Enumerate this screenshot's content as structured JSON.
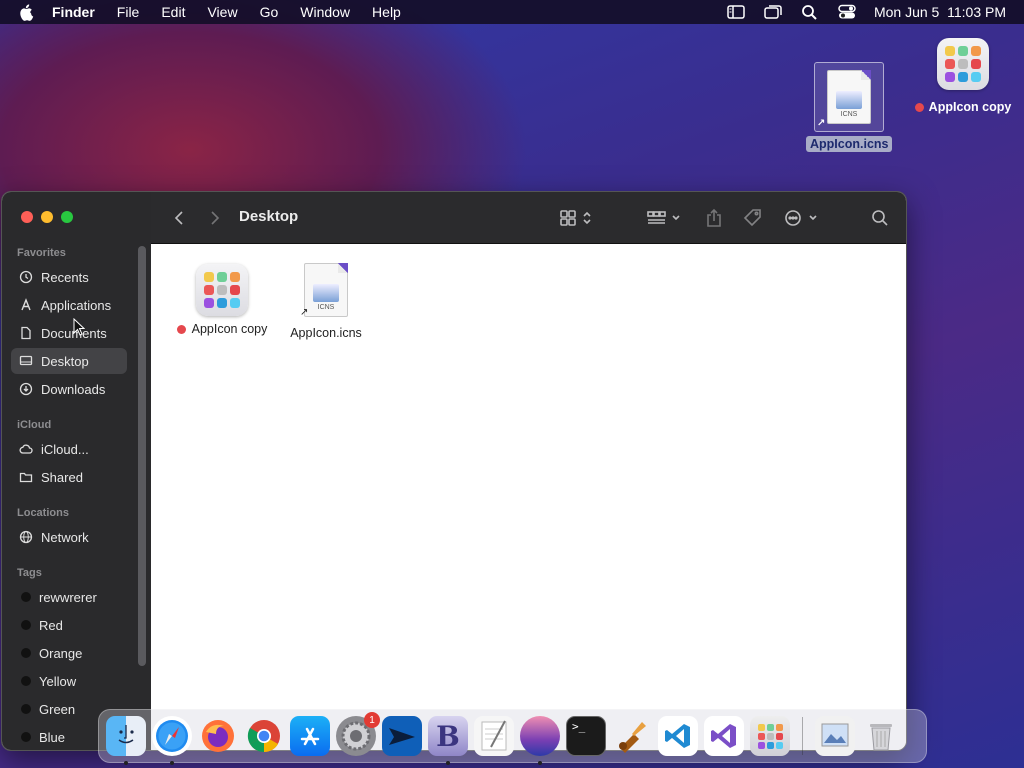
{
  "menubar": {
    "apple_icon": "apple-icon",
    "app_name": "Finder",
    "menus": [
      "File",
      "Edit",
      "View",
      "Go",
      "Window",
      "Help"
    ],
    "status_icons": [
      "sidebar-icon",
      "screen-mirroring-icon",
      "search-icon",
      "control-center-icon"
    ],
    "clock": "Mon Jun 5  11:03 PM"
  },
  "desktop": {
    "icons": [
      {
        "label": "AppIcon.icns",
        "type": "icns-document",
        "selected": true
      },
      {
        "label": "AppIcon copy",
        "type": "app",
        "tag_color": "#e5484d"
      }
    ]
  },
  "finder": {
    "title": "Desktop",
    "sidebar": {
      "sections": [
        {
          "heading": "Favorites",
          "items": [
            {
              "label": "Recents",
              "icon": "clock-icon"
            },
            {
              "label": "Applications",
              "icon": "applications-icon"
            },
            {
              "label": "Documents",
              "icon": "document-icon"
            },
            {
              "label": "Desktop",
              "icon": "desktop-icon",
              "selected": true
            },
            {
              "label": "Downloads",
              "icon": "download-icon"
            }
          ]
        },
        {
          "heading": "iCloud",
          "items": [
            {
              "label": "iCloud...",
              "icon": "cloud-icon"
            },
            {
              "label": "Shared",
              "icon": "shared-folder-icon"
            }
          ]
        },
        {
          "heading": "Locations",
          "items": [
            {
              "label": "Network",
              "icon": "globe-icon"
            }
          ]
        },
        {
          "heading": "Tags",
          "items": [
            {
              "label": "rewwrerer",
              "color": "#111111"
            },
            {
              "label": "Red",
              "color": "#111111"
            },
            {
              "label": "Orange",
              "color": "#111111"
            },
            {
              "label": "Yellow",
              "color": "#111111"
            },
            {
              "label": "Green",
              "color": "#111111"
            },
            {
              "label": "Blue",
              "color": "#111111"
            }
          ]
        }
      ]
    },
    "toolbar_icons": [
      "back-icon",
      "forward-icon",
      "view-grid-icon",
      "group-icon",
      "share-icon",
      "tag-icon",
      "more-icon",
      "search-icon"
    ],
    "files": [
      {
        "label": "AppIcon copy",
        "type": "app",
        "tag_color": "#e5484d"
      },
      {
        "label": "AppIcon.icns",
        "type": "icns-document"
      }
    ],
    "icns_text": "ICNS"
  },
  "dock": {
    "apps": [
      {
        "name": "finder-icon",
        "running": true
      },
      {
        "name": "safari-icon",
        "running": true
      },
      {
        "name": "firefox-icon",
        "running": false
      },
      {
        "name": "chrome-icon",
        "running": false
      },
      {
        "name": "app-store-icon",
        "running": false
      },
      {
        "name": "system-settings-icon",
        "running": false,
        "badge": "1"
      },
      {
        "name": "transmit-icon",
        "running": false
      },
      {
        "name": "bbedit-icon",
        "running": true
      },
      {
        "name": "textedit-icon",
        "running": false
      },
      {
        "name": "macos-wallpaper-icon",
        "running": true
      },
      {
        "name": "terminal-icon",
        "running": false
      },
      {
        "name": "instruments-icon",
        "running": false
      },
      {
        "name": "vscode-icon",
        "running": false
      },
      {
        "name": "visual-studio-icon",
        "running": false
      },
      {
        "name": "launchpad-icon",
        "running": false
      }
    ],
    "others": [
      {
        "name": "preview-document-icon"
      },
      {
        "name": "trash-icon"
      }
    ]
  },
  "colors": {
    "tag_red": "#e5484d",
    "sidebar_bg": "#2a2a2c",
    "toolbar_bg": "#2b2b2d"
  }
}
